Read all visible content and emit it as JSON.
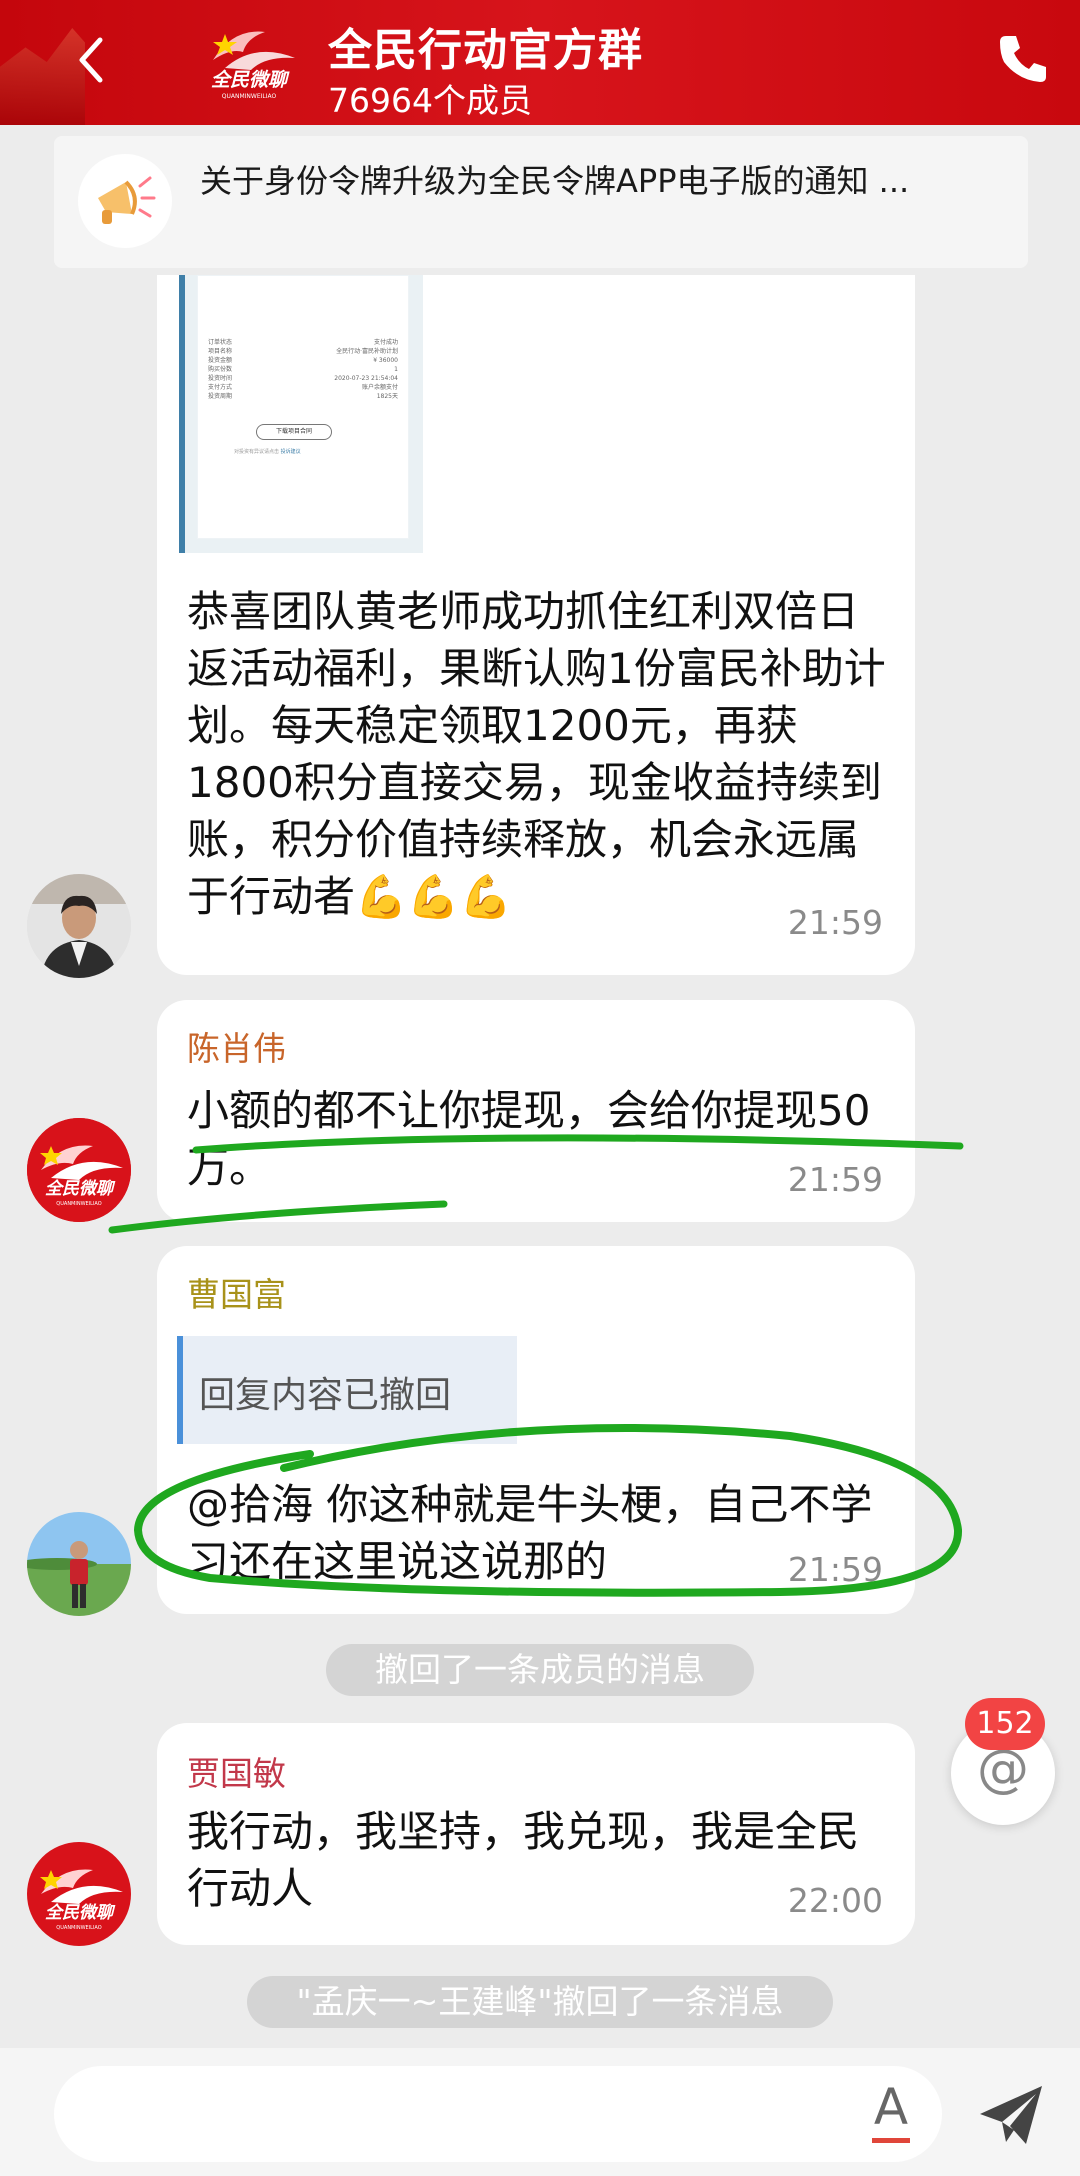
{
  "header": {
    "title": "全民行动官方群",
    "member_count": "76964个成员",
    "logo_text": "全民微聊",
    "logo_subtext": "QUANMINWEILIAO"
  },
  "announcement": {
    "text": "关于身份令牌升级为全民令牌APP电子版的通知 ..."
  },
  "screenshot_card": {
    "rows": [
      [
        "订单状态",
        "支付成功"
      ],
      [
        "项目名称",
        "全民行动·富民补助计划"
      ],
      [
        "投资金额",
        "¥ 36000"
      ],
      [
        "购买份数",
        "1"
      ],
      [
        "投资时间",
        "2020-07-23 21:54:04"
      ],
      [
        "支付方式",
        "账户余额支付"
      ],
      [
        "投资周期",
        "1825天"
      ]
    ],
    "button": "下载项目合同",
    "footnote_prefix": "对投资有异议请点击",
    "footnote_link": "投诉建议"
  },
  "messages": [
    {
      "sender": "",
      "text": "恭喜团队黄老师成功抓住红利双倍日返活动福利，果断认购1份富民补助计划。每天稳定领取1200元，再获1800积分直接交易，现金收益持续到账，积分价值持续释放，机会永远属于行动者💪💪💪",
      "time": "21:59"
    },
    {
      "sender": "陈肖伟",
      "text": "小额的都不让你提现，会给你提现50万。",
      "time": "21:59"
    },
    {
      "sender": "曹国富",
      "quote": "回复内容已撤回",
      "text": "@拾海 你这种就是牛头梗，自己不学习还在这里说这说那的",
      "time": "21:59"
    },
    {
      "sender": "贾国敏",
      "text": "我行动，我坚持，我兑现，我是全民行动人",
      "time": "22:00"
    }
  ],
  "system_messages": [
    "撤回了一条成员的消息",
    "\"孟庆一~王建峰\"撤回了一条消息"
  ],
  "mention": {
    "symbol": "@",
    "badge": "152"
  },
  "input": {
    "font_button": "A"
  },
  "colors": {
    "header_red": "#d7141b",
    "sender_chen": "#c8652a",
    "sender_cao": "#a8921a",
    "sender_jia": "#c2384a",
    "quote_bar": "#4a90d9",
    "annotation_green": "#1fa81f",
    "badge_red": "#f24444"
  }
}
